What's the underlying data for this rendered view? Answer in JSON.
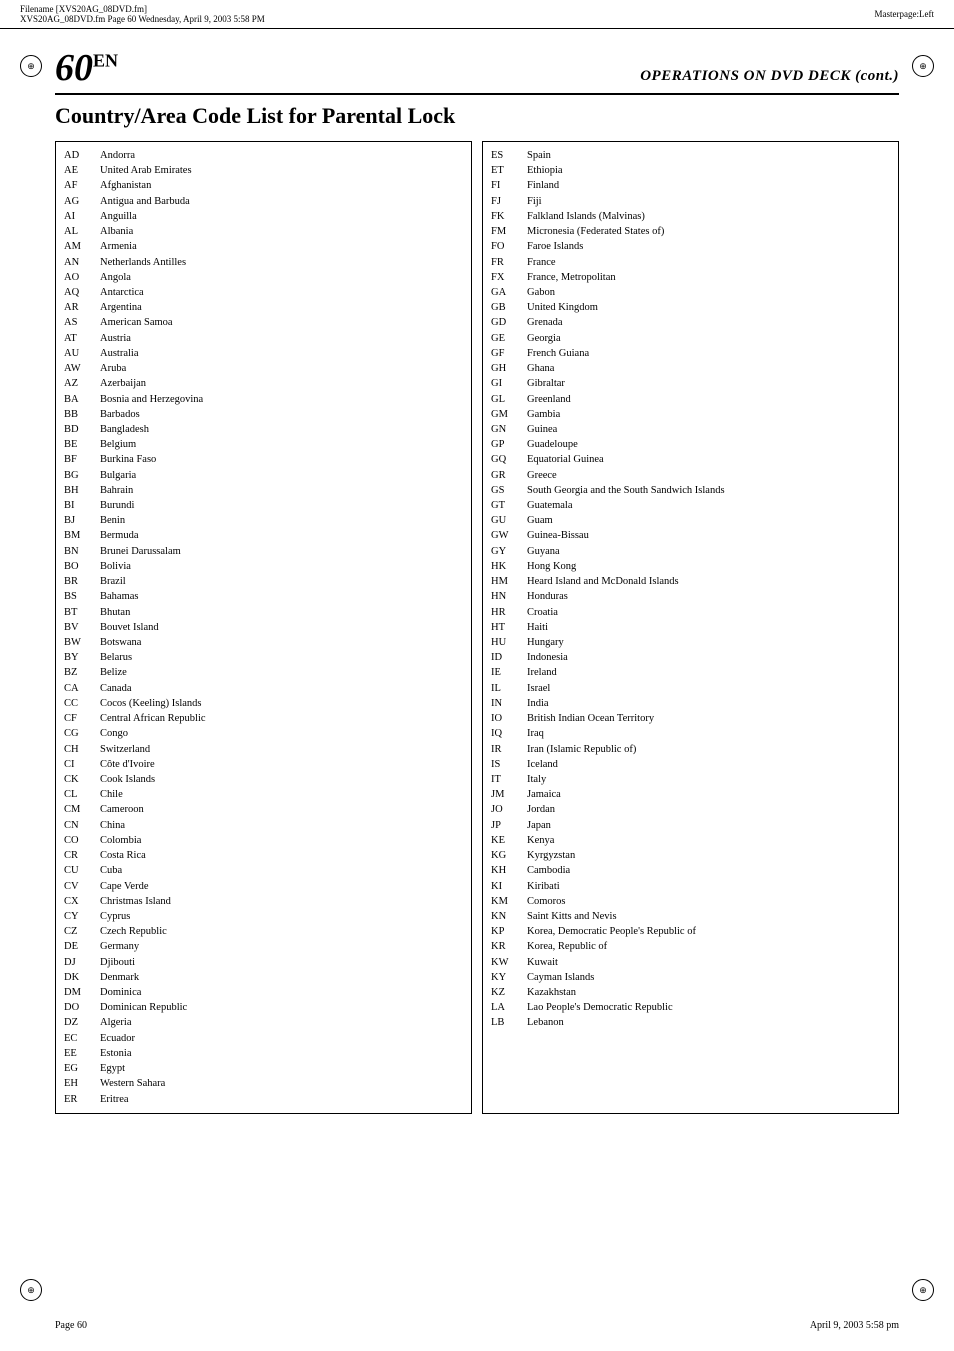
{
  "header": {
    "left_text": "Filename [XVS20AG_08DVD.fm]",
    "left_subtext": "XVS20AG_08DVD.fm  Page 60  Wednesday, April 9, 2003  5:58 PM",
    "right_text": "Masterpage:Left"
  },
  "page": {
    "number": "60",
    "suffix": "EN",
    "operations_title": "OPERATIONS ON DVD DECK (cont.)",
    "section_title": "Country/Area Code List for Parental Lock"
  },
  "left_table": [
    {
      "code": "AD",
      "name": "Andorra"
    },
    {
      "code": "AE",
      "name": "United Arab Emirates"
    },
    {
      "code": "AF",
      "name": "Afghanistan"
    },
    {
      "code": "AG",
      "name": "Antigua and Barbuda"
    },
    {
      "code": "AI",
      "name": "Anguilla"
    },
    {
      "code": "AL",
      "name": "Albania"
    },
    {
      "code": "AM",
      "name": "Armenia"
    },
    {
      "code": "AN",
      "name": "Netherlands Antilles"
    },
    {
      "code": "AO",
      "name": "Angola"
    },
    {
      "code": "AQ",
      "name": "Antarctica"
    },
    {
      "code": "AR",
      "name": "Argentina"
    },
    {
      "code": "AS",
      "name": "American Samoa"
    },
    {
      "code": "AT",
      "name": "Austria"
    },
    {
      "code": "AU",
      "name": "Australia"
    },
    {
      "code": "AW",
      "name": "Aruba"
    },
    {
      "code": "AZ",
      "name": "Azerbaijan"
    },
    {
      "code": "BA",
      "name": "Bosnia and Herzegovina"
    },
    {
      "code": "BB",
      "name": "Barbados"
    },
    {
      "code": "BD",
      "name": "Bangladesh"
    },
    {
      "code": "BE",
      "name": "Belgium"
    },
    {
      "code": "BF",
      "name": "Burkina Faso"
    },
    {
      "code": "BG",
      "name": "Bulgaria"
    },
    {
      "code": "BH",
      "name": "Bahrain"
    },
    {
      "code": "BI",
      "name": "Burundi"
    },
    {
      "code": "BJ",
      "name": "Benin"
    },
    {
      "code": "BM",
      "name": "Bermuda"
    },
    {
      "code": "BN",
      "name": "Brunei Darussalam"
    },
    {
      "code": "BO",
      "name": "Bolivia"
    },
    {
      "code": "BR",
      "name": "Brazil"
    },
    {
      "code": "BS",
      "name": "Bahamas"
    },
    {
      "code": "BT",
      "name": "Bhutan"
    },
    {
      "code": "BV",
      "name": "Bouvet Island"
    },
    {
      "code": "BW",
      "name": "Botswana"
    },
    {
      "code": "BY",
      "name": "Belarus"
    },
    {
      "code": "BZ",
      "name": "Belize"
    },
    {
      "code": "CA",
      "name": "Canada"
    },
    {
      "code": "CC",
      "name": "Cocos (Keeling) Islands"
    },
    {
      "code": "CF",
      "name": "Central African Republic"
    },
    {
      "code": "CG",
      "name": "Congo"
    },
    {
      "code": "CH",
      "name": "Switzerland"
    },
    {
      "code": "CI",
      "name": "Côte d'Ivoire"
    },
    {
      "code": "CK",
      "name": "Cook Islands"
    },
    {
      "code": "CL",
      "name": "Chile"
    },
    {
      "code": "CM",
      "name": "Cameroon"
    },
    {
      "code": "CN",
      "name": "China"
    },
    {
      "code": "CO",
      "name": "Colombia"
    },
    {
      "code": "CR",
      "name": "Costa Rica"
    },
    {
      "code": "CU",
      "name": "Cuba"
    },
    {
      "code": "CV",
      "name": "Cape Verde"
    },
    {
      "code": "CX",
      "name": "Christmas Island"
    },
    {
      "code": "CY",
      "name": "Cyprus"
    },
    {
      "code": "CZ",
      "name": "Czech Republic"
    },
    {
      "code": "DE",
      "name": "Germany"
    },
    {
      "code": "DJ",
      "name": "Djibouti"
    },
    {
      "code": "DK",
      "name": "Denmark"
    },
    {
      "code": "DM",
      "name": "Dominica"
    },
    {
      "code": "DO",
      "name": "Dominican Republic"
    },
    {
      "code": "DZ",
      "name": "Algeria"
    },
    {
      "code": "EC",
      "name": "Ecuador"
    },
    {
      "code": "EE",
      "name": "Estonia"
    },
    {
      "code": "EG",
      "name": "Egypt"
    },
    {
      "code": "EH",
      "name": "Western Sahara"
    },
    {
      "code": "ER",
      "name": "Eritrea"
    }
  ],
  "right_table": [
    {
      "code": "ES",
      "name": "Spain"
    },
    {
      "code": "ET",
      "name": "Ethiopia"
    },
    {
      "code": "FI",
      "name": "Finland"
    },
    {
      "code": "FJ",
      "name": "Fiji"
    },
    {
      "code": "FK",
      "name": "Falkland Islands (Malvinas)"
    },
    {
      "code": "FM",
      "name": "Micronesia (Federated States of)"
    },
    {
      "code": "FO",
      "name": "Faroe Islands"
    },
    {
      "code": "FR",
      "name": "France"
    },
    {
      "code": "FX",
      "name": "France, Metropolitan"
    },
    {
      "code": "GA",
      "name": "Gabon"
    },
    {
      "code": "GB",
      "name": "United Kingdom"
    },
    {
      "code": "GD",
      "name": "Grenada"
    },
    {
      "code": "GE",
      "name": "Georgia"
    },
    {
      "code": "GF",
      "name": "French Guiana"
    },
    {
      "code": "GH",
      "name": "Ghana"
    },
    {
      "code": "GI",
      "name": "Gibraltar"
    },
    {
      "code": "GL",
      "name": "Greenland"
    },
    {
      "code": "GM",
      "name": "Gambia"
    },
    {
      "code": "GN",
      "name": "Guinea"
    },
    {
      "code": "GP",
      "name": "Guadeloupe"
    },
    {
      "code": "GQ",
      "name": "Equatorial Guinea"
    },
    {
      "code": "GR",
      "name": "Greece"
    },
    {
      "code": "GS",
      "name": "South Georgia and the South Sandwich Islands"
    },
    {
      "code": "GT",
      "name": "Guatemala"
    },
    {
      "code": "GU",
      "name": "Guam"
    },
    {
      "code": "GW",
      "name": "Guinea-Bissau"
    },
    {
      "code": "GY",
      "name": "Guyana"
    },
    {
      "code": "HK",
      "name": "Hong Kong"
    },
    {
      "code": "HM",
      "name": "Heard Island and McDonald Islands"
    },
    {
      "code": "HN",
      "name": "Honduras"
    },
    {
      "code": "HR",
      "name": "Croatia"
    },
    {
      "code": "HT",
      "name": "Haiti"
    },
    {
      "code": "HU",
      "name": "Hungary"
    },
    {
      "code": "ID",
      "name": "Indonesia"
    },
    {
      "code": "IE",
      "name": "Ireland"
    },
    {
      "code": "IL",
      "name": "Israel"
    },
    {
      "code": "IN",
      "name": "India"
    },
    {
      "code": "IO",
      "name": "British Indian Ocean Territory"
    },
    {
      "code": "IQ",
      "name": "Iraq"
    },
    {
      "code": "IR",
      "name": "Iran (Islamic Republic of)"
    },
    {
      "code": "IS",
      "name": "Iceland"
    },
    {
      "code": "IT",
      "name": "Italy"
    },
    {
      "code": "JM",
      "name": "Jamaica"
    },
    {
      "code": "JO",
      "name": "Jordan"
    },
    {
      "code": "JP",
      "name": "Japan"
    },
    {
      "code": "KE",
      "name": "Kenya"
    },
    {
      "code": "KG",
      "name": "Kyrgyzstan"
    },
    {
      "code": "KH",
      "name": "Cambodia"
    },
    {
      "code": "KI",
      "name": "Kiribati"
    },
    {
      "code": "KM",
      "name": "Comoros"
    },
    {
      "code": "KN",
      "name": "Saint Kitts and Nevis"
    },
    {
      "code": "KP",
      "name": "Korea, Democratic People's Republic of"
    },
    {
      "code": "KR",
      "name": "Korea, Republic of"
    },
    {
      "code": "KW",
      "name": "Kuwait"
    },
    {
      "code": "KY",
      "name": "Cayman Islands"
    },
    {
      "code": "KZ",
      "name": "Kazakhstan"
    },
    {
      "code": "LA",
      "name": "Lao People's Democratic Republic"
    },
    {
      "code": "LB",
      "name": "Lebanon"
    }
  ],
  "footer": {
    "left": "Page 60",
    "right": "April 9, 2003  5:58 pm"
  }
}
